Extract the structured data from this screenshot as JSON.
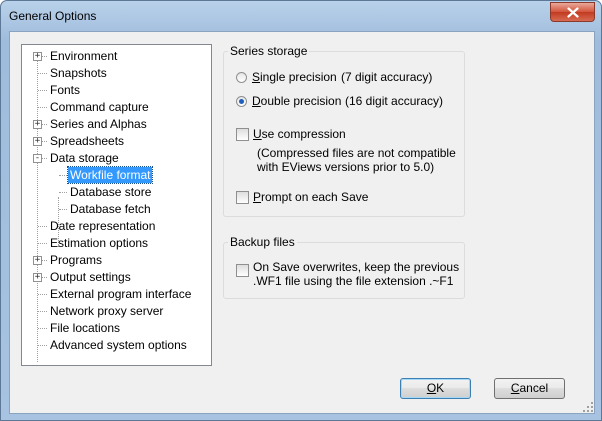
{
  "window": {
    "title": "General Options"
  },
  "tree": {
    "items": [
      {
        "label": "Environment",
        "expander": "+"
      },
      {
        "label": "Snapshots"
      },
      {
        "label": "Fonts"
      },
      {
        "label": "Command capture"
      },
      {
        "label": "Series and Alphas",
        "expander": "+"
      },
      {
        "label": "Spreadsheets",
        "expander": "+"
      },
      {
        "label": "Data storage",
        "expander": "-"
      },
      {
        "label": "Workfile format",
        "selected": true
      },
      {
        "label": "Database store"
      },
      {
        "label": "Database fetch"
      },
      {
        "label": "Date representation"
      },
      {
        "label": "Estimation options"
      },
      {
        "label": "Programs",
        "expander": "+"
      },
      {
        "label": "Output settings",
        "expander": "+"
      },
      {
        "label": "External program interface"
      },
      {
        "label": "Network proxy server"
      },
      {
        "label": "File locations"
      },
      {
        "label": "Advanced system options"
      }
    ]
  },
  "series_storage": {
    "legend": "Series storage",
    "single": {
      "u": "S",
      "rest": "ingle precision",
      "accuracy": "(7 digit accuracy)",
      "checked": false
    },
    "double": {
      "u": "D",
      "rest": "ouble precision",
      "accuracy": "(16 digit accuracy)",
      "checked": true
    },
    "compression": {
      "u": "U",
      "rest": "se compression",
      "checked": false
    },
    "compression_note_1": "(Compressed files are not compatible",
    "compression_note_2": "with EViews versions prior to 5.0)",
    "prompt": {
      "u": "P",
      "rest": "rompt on each Save",
      "checked": false
    }
  },
  "backup": {
    "legend": "Backup files",
    "line1": "On Save overwrites, keep the previous",
    "line2": ".WF1 file using the file extension .~F1",
    "checked": false
  },
  "buttons": {
    "ok": {
      "u": "O",
      "rest": "K"
    },
    "cancel": {
      "u": "C",
      "rest": "ancel"
    }
  },
  "colors": {
    "selection": "#3399ff",
    "title_bar": "#b9d1ea",
    "close": "#c23a1f"
  },
  "icons": {
    "close": "close-x-icon",
    "grip": "resize-grip-icon"
  }
}
